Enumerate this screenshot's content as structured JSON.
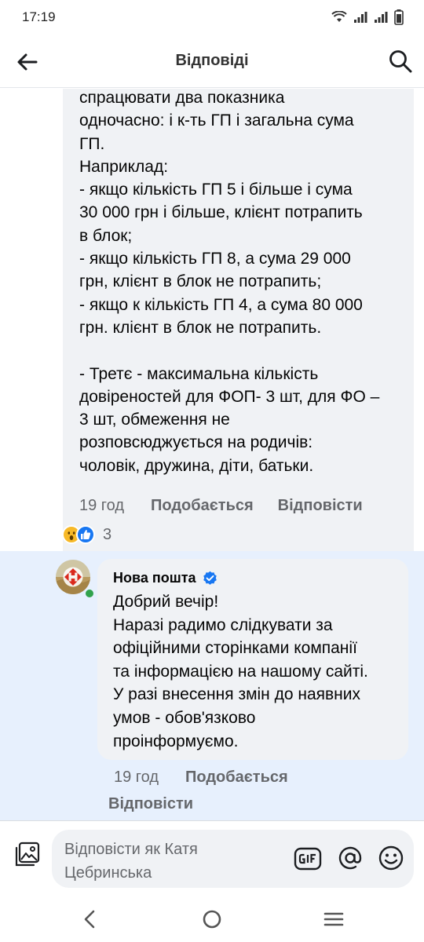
{
  "status_bar": {
    "time": "17:19"
  },
  "header": {
    "title": "Відповіді"
  },
  "comment1": {
    "text": "спрацювати два показника\nодночасно: і к-ть ГП і загальна сума\nГП.\nНаприклад:\n- якщо кількість ГП 5 і більше і сума\n30 000 грн і більше, клієнт потрапить\nв блок;\n- якщо кількість ГП 8, а сума 29 000\nгрн, клієнт в блок не потрапить;\n- якщо к кількість ГП 4, а сума 80 000\nгрн. клієнт в блок не потрапить.\n\n- Третє - максимальна кількість\nдовіреностей для ФОП- 3 шт, для ФО –\n3 шт, обмеження не\nрозповсюджується на родичів:\nчоловік, дружина, діти, батьки.",
    "time": "19 год",
    "like_label": "Подобається",
    "reply_label": "Відповісти",
    "reactions": [
      "wow",
      "like"
    ],
    "reaction_count": "3"
  },
  "comment2": {
    "author": "Нова пошта",
    "verified": true,
    "text": "Добрий вечір!\nНаразі радимо слідкувати за\nофіційними сторінками компанії\nта інформацією на нашому сайті.\nУ разі внесення змін до наявних\nумов - обов'язково\nпроінформуємо.",
    "time": "19 год",
    "like_label": "Подобається",
    "reply_label": "Відповісти"
  },
  "reply_bar": {
    "placeholder": "Відповісти як Катя Цебринська",
    "icons": [
      "photo-icon",
      "gif-icon",
      "mention-icon",
      "emoji-icon"
    ]
  },
  "colors": {
    "bubble": "#f0f2f5",
    "highlight": "#e7f0fd",
    "secondary_text": "#65676b",
    "brand_blue": "#1877f2",
    "online": "#31a24c",
    "novaposhta_red": "#da291c"
  }
}
